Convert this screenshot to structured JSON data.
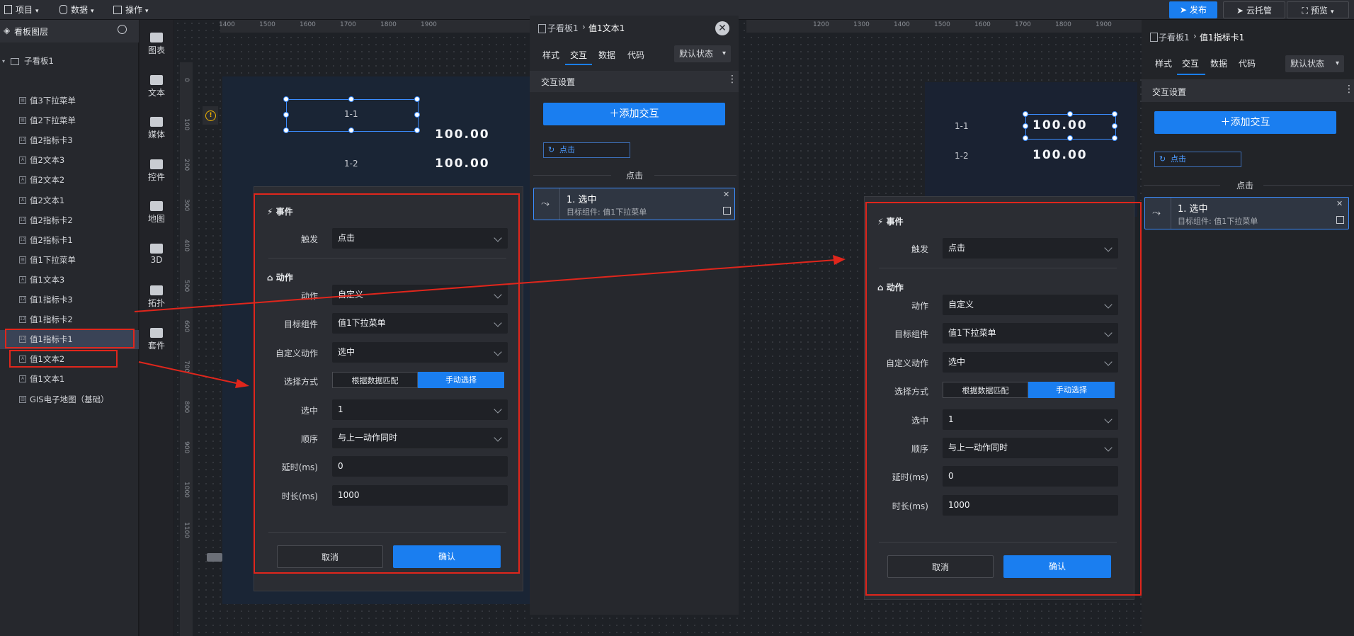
{
  "topbar": {
    "menus": [
      {
        "label": "项目"
      },
      {
        "label": "数据"
      },
      {
        "label": "操作"
      }
    ],
    "publish_label": "发布",
    "cloud_label": "云托管",
    "preview_label": "预览"
  },
  "layers": {
    "title": "看板图层",
    "group": "子看板1",
    "items": [
      {
        "label": "值3下拉菜单",
        "kind": "select"
      },
      {
        "label": "值2下拉菜单",
        "kind": "select"
      },
      {
        "label": "值2指标卡3",
        "kind": "card"
      },
      {
        "label": "值2文本3",
        "kind": "text"
      },
      {
        "label": "值2文本2",
        "kind": "text"
      },
      {
        "label": "值2文本1",
        "kind": "text"
      },
      {
        "label": "值2指标卡2",
        "kind": "card"
      },
      {
        "label": "值2指标卡1",
        "kind": "card"
      },
      {
        "label": "值1下拉菜单",
        "kind": "select"
      },
      {
        "label": "值1文本3",
        "kind": "text"
      },
      {
        "label": "值1指标卡3",
        "kind": "card"
      },
      {
        "label": "值1指标卡2",
        "kind": "card"
      },
      {
        "label": "值1指标卡1",
        "kind": "card"
      },
      {
        "label": "值1文本2",
        "kind": "text"
      },
      {
        "label": "值1文本1",
        "kind": "text"
      },
      {
        "label": "GIS电子地图（基础）",
        "kind": "map"
      }
    ]
  },
  "strip": [
    {
      "label": "图表"
    },
    {
      "label": "文本"
    },
    {
      "label": "媒体"
    },
    {
      "label": "控件"
    },
    {
      "label": "地图"
    },
    {
      "label": "3D"
    },
    {
      "label": "拓扑"
    },
    {
      "label": "套件"
    }
  ],
  "ruler": {
    "top_left": [
      "1400",
      "1500",
      "1600",
      "1700",
      "1800",
      "1900"
    ],
    "top_right": [
      "1200",
      "1300",
      "1400",
      "1500",
      "1600",
      "1700",
      "1800",
      "1900"
    ],
    "left": [
      "0",
      "100",
      "200",
      "300",
      "400",
      "500",
      "600",
      "700",
      "800",
      "900",
      "1000",
      "1100"
    ]
  },
  "canvas": {
    "label_1_1": "1-1",
    "label_1_2": "1-2",
    "value_1": "100.00",
    "value_2": "100.00"
  },
  "dialog": {
    "event_title": "事件",
    "trigger_label": "触发",
    "trigger_value": "点击",
    "action_title": "动作",
    "action_label": "动作",
    "action_value": "自定义",
    "target_label": "目标组件",
    "target_value": "值1下拉菜单",
    "custom_label": "自定义动作",
    "custom_value": "选中",
    "mode_label": "选择方式",
    "mode_data": "根据数据匹配",
    "mode_manual": "手动选择",
    "selected_label": "选中",
    "selected_value": "1",
    "order_label": "顺序",
    "order_value": "与上一动作同时",
    "delay_label": "延时(ms)",
    "delay_value": "0",
    "duration_label": "时长(ms)",
    "duration_value": "1000",
    "cancel_label": "取消",
    "confirm_label": "确认"
  },
  "panel_mid": {
    "breadcrumb_root": "子看板1",
    "breadcrumb_sep": "›",
    "breadcrumb_item": "值1文本1",
    "tabs": [
      {
        "label": "样式"
      },
      {
        "label": "交互"
      },
      {
        "label": "数据"
      },
      {
        "label": "代码"
      }
    ],
    "state": "默认状态",
    "section_title": "交互设置",
    "add_label": "添加交互",
    "event_tag": "点击",
    "group_label": "点击",
    "card_title": "1. 选中",
    "card_sub": "目标组件: 值1下拉菜单"
  },
  "panel_right": {
    "breadcrumb_root": "子看板1",
    "breadcrumb_sep": "›",
    "breadcrumb_item": "值1指标卡1",
    "tabs": [
      {
        "label": "样式"
      },
      {
        "label": "交互"
      },
      {
        "label": "数据"
      },
      {
        "label": "代码"
      }
    ],
    "state": "默认状态",
    "section_title": "交互设置",
    "add_label": "添加交互",
    "event_tag": "点击",
    "group_label": "点击",
    "card_title": "1. 选中",
    "card_sub": "目标组件: 值1下拉菜单"
  },
  "colors": {
    "accent": "#1a7ef0",
    "highlight": "#e0261c",
    "selection": "#3b8dff"
  }
}
